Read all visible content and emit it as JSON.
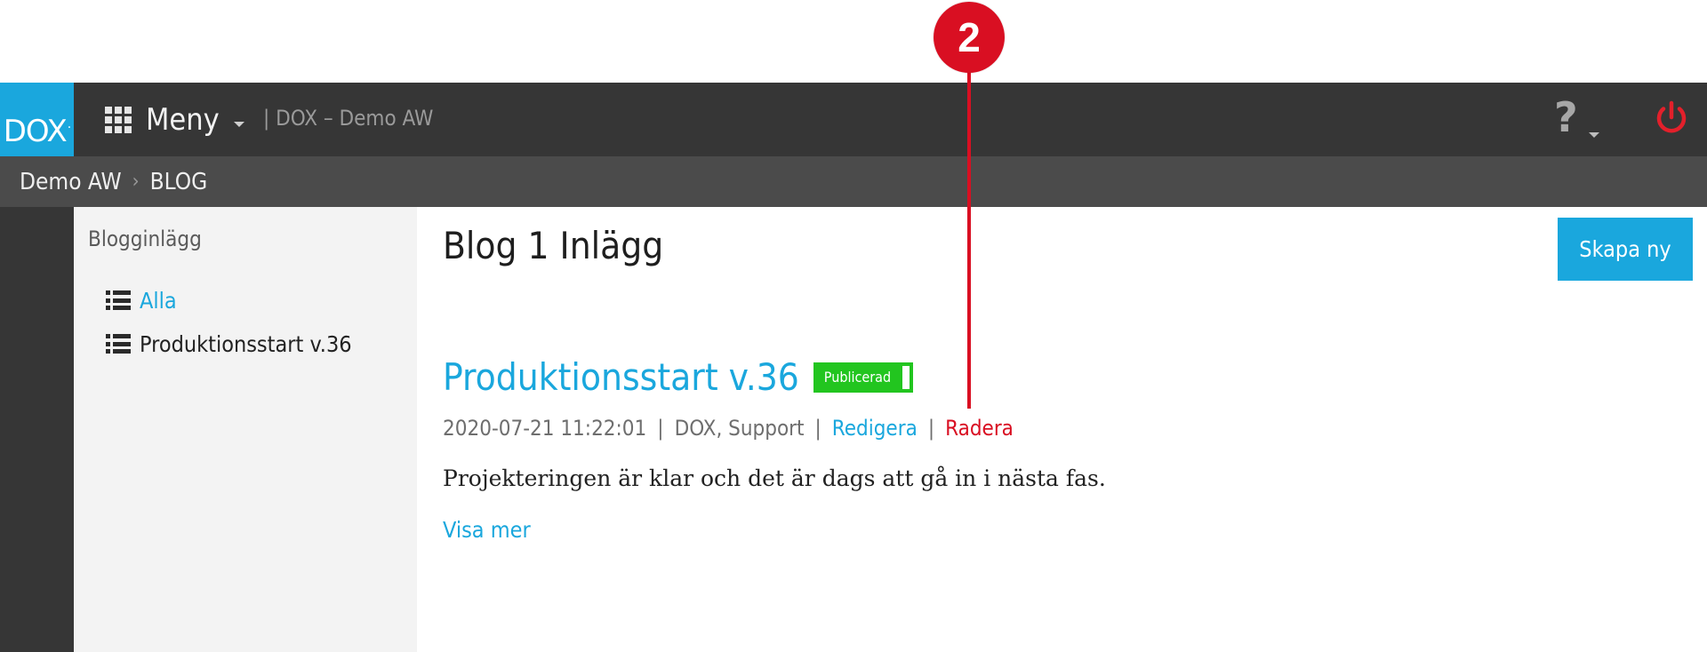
{
  "annotation": {
    "number": "2"
  },
  "topbar": {
    "logo_text": "DOX",
    "logo_dot": "·",
    "menu_label": "Meny",
    "site_name": "| DOX – Demo AW",
    "help_label": "?"
  },
  "breadcrumb": {
    "items": [
      {
        "label": "Demo AW"
      },
      {
        "label": "BLOG"
      }
    ],
    "separator": "›"
  },
  "sidebar": {
    "title": "Blogginlägg",
    "items": [
      {
        "label": "Alla",
        "active": true
      },
      {
        "label": "Produktionsstart v.36",
        "active": false
      }
    ]
  },
  "main": {
    "title": "Blog 1 Inlägg",
    "create_button": "Skapa ny",
    "post": {
      "title": "Produktionsstart v.36",
      "status": "Publicerad",
      "date": "2020-07-21 11:22:01",
      "authors": "DOX, Support",
      "edit_link": "Redigera",
      "delete_link": "Radera",
      "separator": "|",
      "excerpt": "Projekteringen är klar och det är dags att gå in i nästa fas.",
      "read_more": "Visa mer"
    }
  },
  "colors": {
    "accent": "#1aa7dd",
    "annotation": "#d90f22",
    "status_published": "#22c51f",
    "topbar": "#363636",
    "breadcrumb_bar": "#4b4b4b",
    "power_icon": "#e3202b"
  },
  "icons": {
    "menu": "grid-icon",
    "help": "question-icon",
    "power": "power-icon",
    "list": "list-icon",
    "breadcrumb_separator": "chevron-right-icon"
  }
}
